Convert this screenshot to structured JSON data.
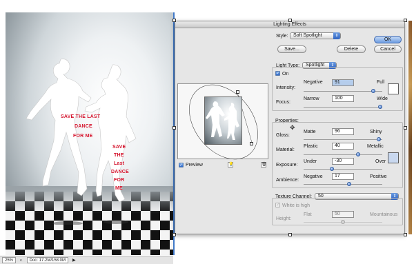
{
  "document": {
    "poster_lines": [
      "SAVE THE LAST",
      "DANCE",
      "FOR ME",
      "SAVE",
      "THE",
      "Last",
      "DANCE",
      "FOR",
      "ME"
    ],
    "status": {
      "zoom": "25%",
      "doc_info": "Doc: 17.2M/158.0M"
    }
  },
  "dialog": {
    "title": "Lighting Effects",
    "style": {
      "label": "Style:",
      "value": "Soft Spotlight"
    },
    "buttons": {
      "save": "Save...",
      "delete": "Delete",
      "ok": "OK",
      "cancel": "Cancel"
    },
    "preview": {
      "checkbox_label": "Preview",
      "checked": true
    },
    "light_type": {
      "label": "Light Type:",
      "value": "Spotlight",
      "on_label": "On",
      "on_checked": true
    },
    "intensity": {
      "label": "Intensity:",
      "min_label": "Negative",
      "value": "91",
      "max_label": "Full",
      "level": 0.91,
      "color": "#ffffff"
    },
    "focus": {
      "label": "Focus:",
      "min_label": "Narrow",
      "value": "100",
      "max_label": "Wide",
      "level": 1.0
    },
    "properties": {
      "label": "Properties:",
      "gloss": {
        "label": "Gloss:",
        "min_label": "Matte",
        "value": "96",
        "max_label": "Shiny",
        "level": 0.98
      },
      "material": {
        "label": "Material:",
        "min_label": "Plastic",
        "value": "40",
        "max_label": "Metallic",
        "level": 0.7
      },
      "exposure": {
        "label": "Exposure:",
        "min_label": "Under",
        "value": "-30",
        "max_label": "Over",
        "level": 0.35
      },
      "ambience": {
        "label": "Ambience:",
        "min_label": "Negative",
        "value": "17",
        "max_label": "Positive",
        "level": 0.58
      },
      "color": "#c9d8ef"
    },
    "texture": {
      "label": "Texture Channel:",
      "value": "50",
      "white_is_high_label": "White is high",
      "white_is_high_checked": true,
      "height_label": "Height:",
      "min_label": "Flat",
      "max_label": "Mountainous",
      "level": 0.5
    }
  },
  "colors": {
    "accent": "#2c66c6",
    "poster_red": "#d4122b"
  }
}
